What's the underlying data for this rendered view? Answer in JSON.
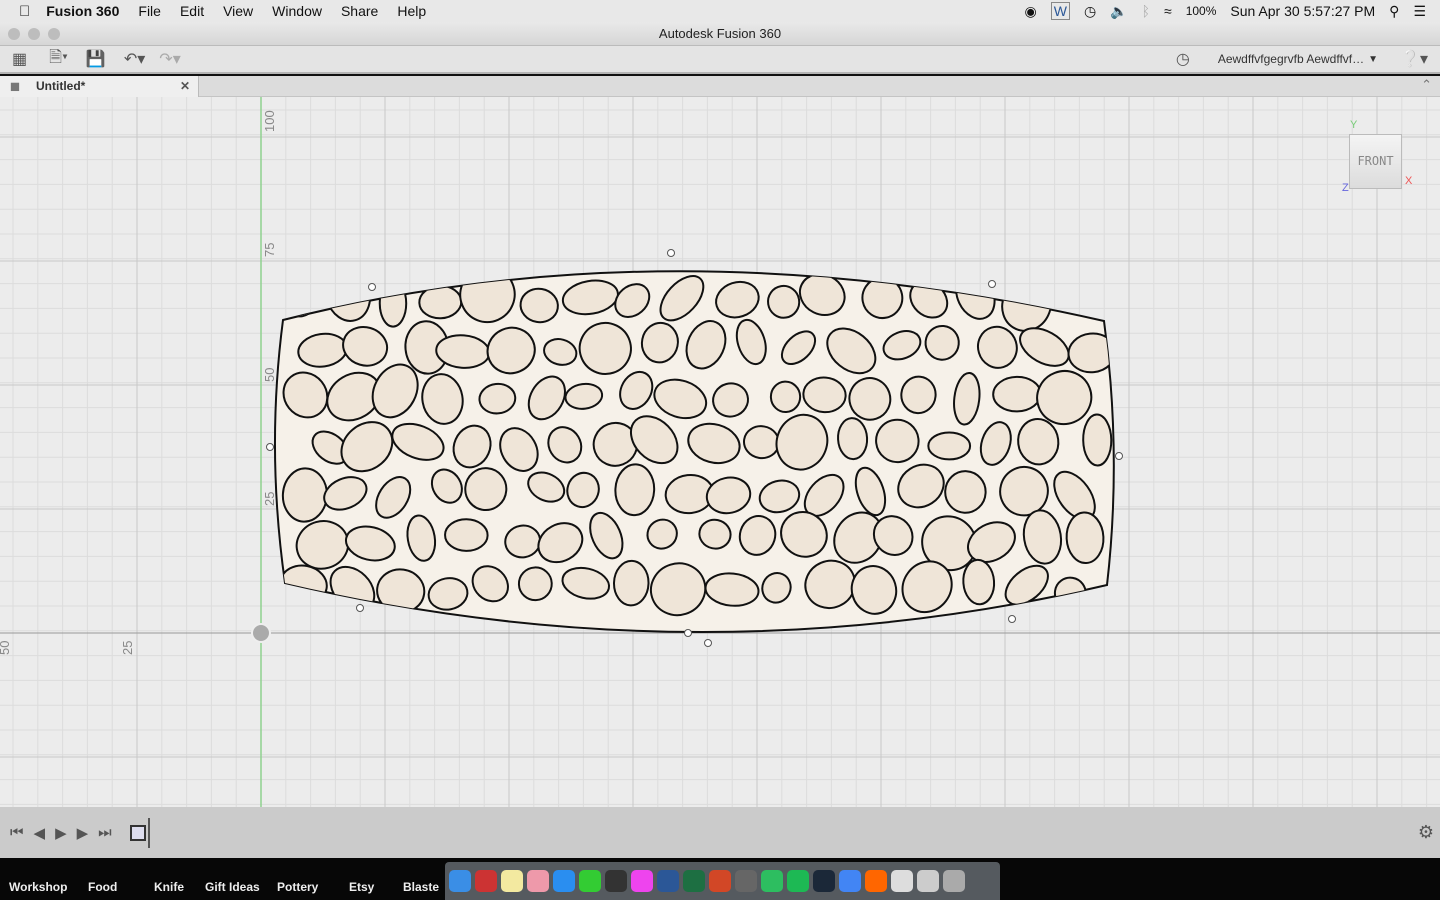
{
  "menubar": {
    "app": "Fusion 360",
    "items": [
      "File",
      "Edit",
      "View",
      "Window",
      "Share",
      "Help"
    ],
    "battery": "100%",
    "datetime": "Sun Apr 30  5:57:27 PM"
  },
  "window": {
    "title": "Autodesk Fusion 360"
  },
  "toolbar": {
    "user": "Aewdffvfgegrvfb Aewdffvf…"
  },
  "tab": {
    "label": "Untitled*"
  },
  "viewcube": {
    "face": "FRONT",
    "axes": {
      "x": "X",
      "y": "Y",
      "z": "Z"
    }
  },
  "rulers": {
    "vertical": [
      "100",
      "75",
      "50",
      "25"
    ],
    "horizontal": [
      "25",
      "50"
    ]
  },
  "bottom_folders": [
    "Workshop",
    "Food",
    "Knife",
    "Gift Ideas",
    "Pottery",
    "Etsy",
    "Blaste"
  ],
  "colors": {
    "sketch_fill": "#efe5d8",
    "axis_green": "#8fd18f",
    "grid": "#d8d8d8"
  }
}
